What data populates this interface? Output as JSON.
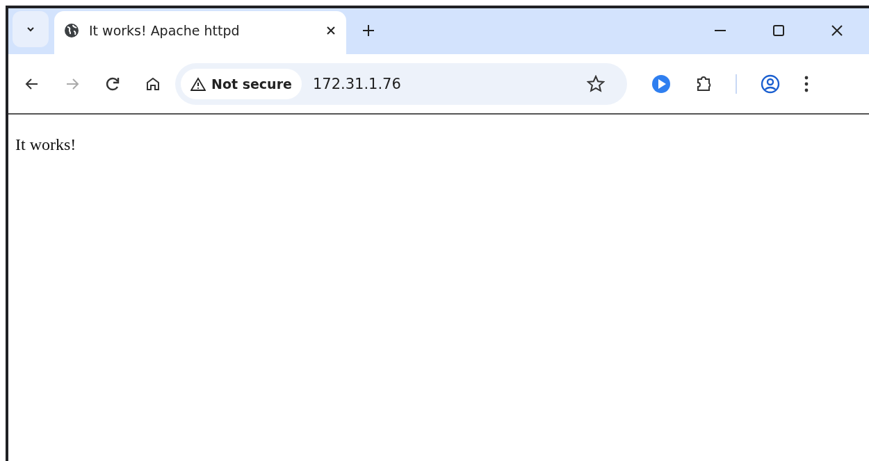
{
  "tabs": [
    {
      "title": "It works! Apache httpd",
      "selected": true
    }
  ],
  "address_bar": {
    "security_label": "Not secure",
    "url": "172.31.1.76"
  },
  "page": {
    "text": "It works!"
  }
}
